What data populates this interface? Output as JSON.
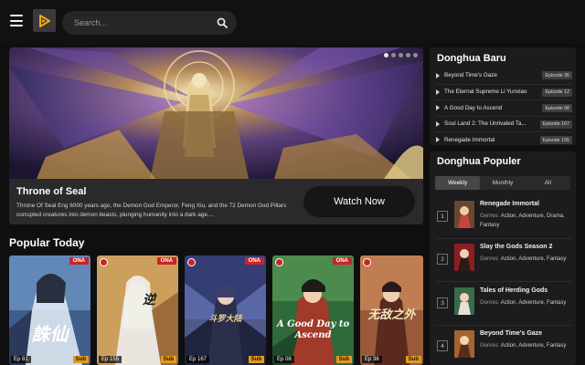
{
  "header": {
    "search_placeholder": "Search...",
    "menu_icon": "hamburger-menu-icon",
    "logo_icon": "play-logo-icon",
    "search_icon": "search-icon"
  },
  "hero": {
    "title": "Throne of Seal",
    "description": "Throne Of Seal Eng 6000 years ago, the Demon God Emperor, Feng Xiu, and the 72 Demon God Pillars corrupted creatures into demon beasts, plunging humanity into a dark age....",
    "watch_label": "Watch Now",
    "slides": 5,
    "active_slide": 1
  },
  "popular_today": {
    "title": "Popular Today",
    "cards": [
      {
        "ep": "Ep 81",
        "type": "ONA",
        "sub": "Sub",
        "art_text": "誅仙"
      },
      {
        "ep": "Ep 155",
        "type": "ONA",
        "sub": "Sub",
        "art_text": "逆"
      },
      {
        "ep": "Ep 167",
        "type": "ONA",
        "sub": "Sub",
        "art_text": "斗罗大陆"
      },
      {
        "ep": "Ep 08",
        "type": "ONA",
        "sub": "Sub",
        "art_text": "A Good Day to Ascend"
      },
      {
        "ep": "Ep 36",
        "type": "",
        "sub": "Sub",
        "art_text": "无敌之外"
      }
    ]
  },
  "donghua_baru": {
    "title": "Donghua Baru",
    "items": [
      {
        "name": "Beyond Time's Gaze",
        "ep": "Episode 36"
      },
      {
        "name": "The Eternal Supreme Li Yunxiao",
        "ep": "Episode 12"
      },
      {
        "name": "A Good Day to Ascend",
        "ep": "Episode 08"
      },
      {
        "name": "Soul Land 2: The Unrivaled Ta...",
        "ep": "Episode 167"
      },
      {
        "name": "Renegade Immortal",
        "ep": "Episode 155"
      }
    ]
  },
  "donghua_populer": {
    "title": "Donghua Populer",
    "tabs": [
      "Weekly",
      "Monthly",
      "All"
    ],
    "active_tab": "Weekly",
    "genres_label": "Genres:",
    "items": [
      {
        "rank": "1",
        "title": "Renegade Immortal",
        "genres": "Action, Adventure, Drama, Fantasy"
      },
      {
        "rank": "2",
        "title": "Slay the Gods Season 2",
        "genres": "Action, Adventure, Fantasy"
      },
      {
        "rank": "3",
        "title": "Tales of Herding Gods",
        "genres": "Action, Adventure, Fantasy"
      },
      {
        "rank": "4",
        "title": "Beyond Time's Gaze",
        "genres": "Action, Adventure, Fantasy"
      }
    ]
  }
}
